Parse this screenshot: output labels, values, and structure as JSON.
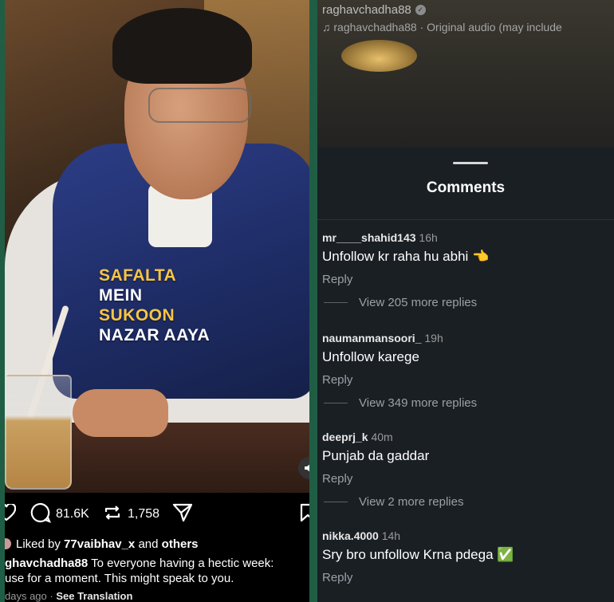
{
  "post": {
    "overlay_lines": [
      "SAFALTA",
      "MEIN",
      "SUKOON",
      "NAZAR AAYA"
    ],
    "stats": {
      "comments": "81.6K",
      "reposts": "1,758"
    },
    "liked_prefix": "Liked by",
    "liked_user": "77vaibhav_x",
    "liked_and": "and",
    "liked_others": "others",
    "caption_user": "ghavchadha88",
    "caption_line1": "To everyone having a hectic week:",
    "caption_line2": "use for a moment. This might speak to you.",
    "age": "days ago",
    "see_translation": "See Translation"
  },
  "reel_header": {
    "username": "raghavchadha88",
    "audio": "raghavchadha88 · Original audio  (may include"
  },
  "comments_sheet": {
    "title": "Comments",
    "comments": [
      {
        "user": "mr____shahid143",
        "time": "16h",
        "text": "Unfollow kr raha hu abhi 👈",
        "reply": "Reply",
        "more": "View 205 more replies"
      },
      {
        "user": "naumanmansoori_",
        "time": "19h",
        "text": "Unfollow karege",
        "reply": "Reply",
        "more": "View 349 more replies"
      },
      {
        "user": "deeprj_k",
        "time": "40m",
        "text": "Punjab da gaddar",
        "reply": "Reply",
        "more": "View 2 more replies"
      },
      {
        "user": "nikka.4000",
        "time": "14h",
        "text": "Sry bro unfollow Krna pdega ✅",
        "reply": "Reply"
      }
    ]
  },
  "icons": [
    "heart-icon",
    "comment-icon",
    "repost-icon",
    "share-icon",
    "bookmark-icon",
    "mute-icon",
    "music-note-icon",
    "verified-badge-icon"
  ]
}
